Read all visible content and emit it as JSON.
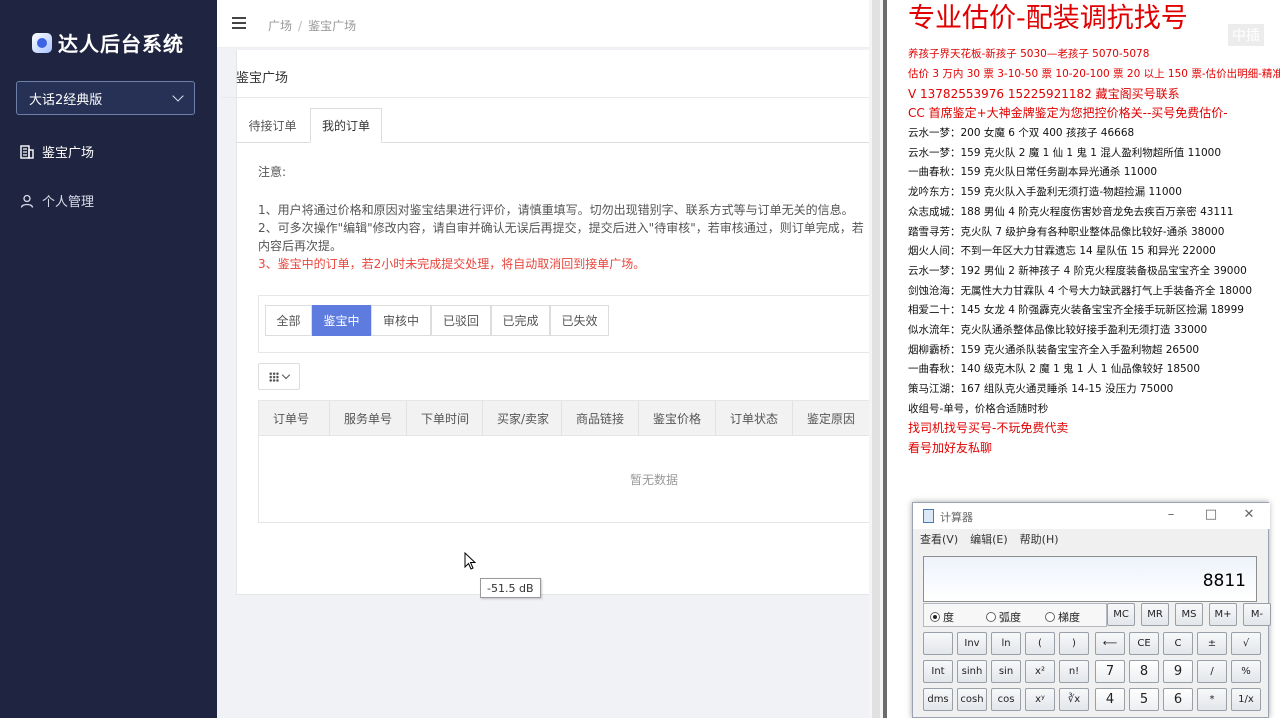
{
  "sidebar": {
    "logo_text": "达人后台系统",
    "version_select": "大话2经典版",
    "menu": [
      {
        "label": "鉴宝广场",
        "icon": "building-icon"
      },
      {
        "label": "个人管理",
        "icon": "user-icon"
      }
    ],
    "bg_color": "#1f2541"
  },
  "header": {
    "breadcrumb": [
      "广场",
      "鉴宝广场"
    ]
  },
  "main": {
    "page_title": "鉴宝广场",
    "tabs": [
      {
        "label": "待接订单",
        "active": false
      },
      {
        "label": "我的订单",
        "active": true
      }
    ],
    "notes": {
      "title": "注意:",
      "line1": "1、用户将通过价格和原因对鉴宝结果进行评价，请慎重填写。切勿出现错别字、联系方式等与订单无关的信息。",
      "line2": "2、可多次操作\"编辑\"修改内容，请自审并确认无误后再提交，提交后进入\"待审核\"，若审核通过，则订单完成，若",
      "line2b": "内容后再次提。",
      "line3": "3、鉴宝中的订单，若2小时未完成提交处理，将自动取消回到接单广场。"
    },
    "filters": [
      {
        "label": "全部",
        "active": false
      },
      {
        "label": "鉴宝中",
        "active": true
      },
      {
        "label": "审核中",
        "active": false
      },
      {
        "label": "已驳回",
        "active": false
      },
      {
        "label": "已完成",
        "active": false
      },
      {
        "label": "已失效",
        "active": false
      }
    ],
    "table": {
      "columns": [
        "订单号",
        "服务单号",
        "下单时间",
        "买家/卖家",
        "商品链接",
        "鉴宝价格",
        "订单状态",
        "鉴定原因"
      ],
      "empty_text": "暂无数据"
    },
    "tooltip": "-51.5 dB",
    "accent_color": "#5e7ce0"
  },
  "document": {
    "heading": "专业估价-配装调抗找号",
    "watermark": "中插",
    "lines": [
      {
        "text": "养孩子界天花板-新孩子 5030—老孩子 5070-5078",
        "color": "red"
      },
      {
        "text": "估价 3 万内 30 票  3-10-50 票  10-20-100 票  20 以上 150 票-估价出明细-精准",
        "color": "red"
      },
      {
        "text": "V 13782553976    15225921182   藏宝阁买号联系",
        "color": "red",
        "big": true
      },
      {
        "text": "CC 首席鉴定+大神金牌鉴定为您把控价格关--买号免费估价-",
        "color": "red",
        "big": true
      },
      {
        "text": "云水一梦：200 女魔 6 个双 400 孩孩子 46668",
        "color": "black"
      },
      {
        "text": "云水一梦：159 克火队 2 魔 1 仙 1 鬼 1 混人盈利物超所值 11000",
        "color": "black"
      },
      {
        "text": "一曲春秋：159 克火队日常任务副本异光通杀 11000",
        "color": "black"
      },
      {
        "text": "龙吟东方：159 克火队入手盈利无须打造-物超捡漏 11000",
        "color": "black"
      },
      {
        "text": "众志成城：188 男仙 4 阶克火程度伤害妙音龙免去疾百万亲密 43111",
        "color": "black"
      },
      {
        "text": "踏雪寻芳：克火队 7 级护身有各种职业整体品像比较好-通杀 38000",
        "color": "black"
      },
      {
        "text": "烟火人间：不到一年区大力甘霖遗忘 14 星队伍 15 和异光 22000",
        "color": "black"
      },
      {
        "text": "云水一梦：192 男仙 2 新神孩子 4 阶克火程度装备极品宝宝齐全 39000",
        "color": "black"
      },
      {
        "text": "剑蚀沧海：无属性大力甘霖队 4 个号大力缺武器打气上手装备齐全 18000",
        "color": "black"
      },
      {
        "text": "相爱二十：145 女龙 4 阶强霹克火装备宝宝齐全接手玩新区捡漏 18999",
        "color": "black"
      },
      {
        "text": "似水流年：克火队通杀整体品像比较好接手盈利无须打造 33000",
        "color": "black"
      },
      {
        "text": "烟柳霸桥：159 克火通杀队装备宝宝齐全入手盈利物超 26500",
        "color": "black"
      },
      {
        "text": "一曲春秋：140 级克木队 2 魔 1 鬼 1 人 1 仙品像较好 18500",
        "color": "black"
      },
      {
        "text": "策马江湖：167 组队克火通灵睡杀 14-15 没压力 75000",
        "color": "black"
      },
      {
        "text": "收组号-单号，价格合适随时秒",
        "color": "black"
      },
      {
        "text": "找司机找号买号-不玩免费代卖",
        "color": "red",
        "big": true
      },
      {
        "text": "看号加好友私聊",
        "color": "red",
        "big": true
      }
    ]
  },
  "calculator": {
    "title": "计算器",
    "menu": [
      "查看(V)",
      "编辑(E)",
      "帮助(H)"
    ],
    "display": "8811",
    "angle_modes": [
      {
        "label": "度",
        "checked": true
      },
      {
        "label": "弧度",
        "checked": false
      },
      {
        "label": "梯度",
        "checked": false
      }
    ],
    "memory_keys": [
      "MC",
      "MR",
      "MS",
      "M+",
      "M-"
    ],
    "row2": [
      "",
      "Inv",
      "ln",
      "(",
      ")",
      "⟵",
      "CE",
      "C",
      "±",
      "√"
    ],
    "row3": [
      "Int",
      "sinh",
      "sin",
      "x²",
      "n!",
      "7",
      "8",
      "9",
      "/",
      "%"
    ],
    "row4": [
      "dms",
      "cosh",
      "cos",
      "xʸ",
      "∛x",
      "4",
      "5",
      "6",
      "*",
      "1/x"
    ]
  }
}
